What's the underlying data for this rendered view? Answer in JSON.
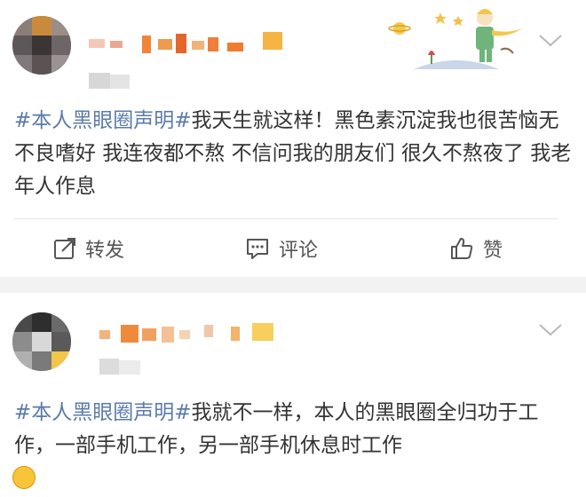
{
  "posts": [
    {
      "hashtag": "#本人黑眼圈声明#",
      "text": "我天生就这样！黑色素沉淀我也很苦恼无不良嗜好 我连夜都不熬 不信问我的朋友们 很久不熬夜了 我老年人作息",
      "actions": {
        "repost": "转发",
        "comment": "评论",
        "like": "赞"
      }
    },
    {
      "hashtag": "#本人黑眼圈声明#",
      "text": "我就不一样，本人的黑眼圈全归功于工作，一部手机工作，另一部手机休息时工作"
    }
  ],
  "colors": {
    "hashtag": "#5b7ba8",
    "text": "#333333",
    "background": "#f2f2f2"
  },
  "icons": [
    "chevron-down-icon",
    "repost-icon",
    "comment-icon",
    "like-icon",
    "emoji-icon"
  ]
}
